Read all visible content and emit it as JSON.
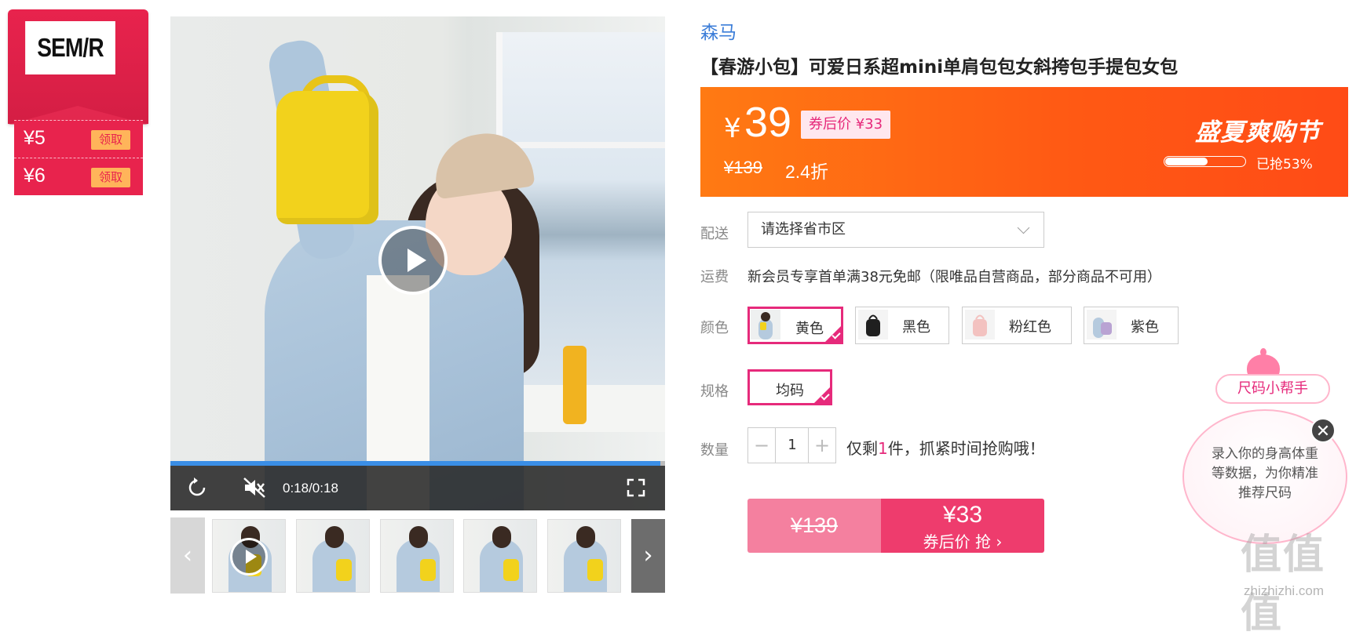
{
  "brand_badge": {
    "logo_text": "SEM/R"
  },
  "coupons": [
    {
      "amount": "¥5",
      "button": "领取"
    },
    {
      "amount": "¥6",
      "button": "领取"
    }
  ],
  "video": {
    "time": "0:18/0:18",
    "progress": 0.99
  },
  "thumbnails": {
    "prev": "‹",
    "next": "›"
  },
  "product": {
    "brand": "森马",
    "title": "【春游小包】可爱日系超mini单肩包包女斜挎包手提包女包"
  },
  "price_banner": {
    "currency": "¥",
    "price": "39",
    "coupon_price": "券后价 ¥33",
    "original_price": "¥139",
    "discount": "2.4折",
    "promo_title": "盛夏爽购节",
    "sold_text": "已抢53%",
    "sold_fraction": 0.53,
    "gradient_colors": [
      "#ff7a13",
      "#ff4b16"
    ]
  },
  "delivery": {
    "label": "配送",
    "placeholder": "请选择省市区"
  },
  "freight": {
    "label": "运费",
    "text": "新会员专享首单满38元免邮（限唯品自营商品，部分商品不可用）"
  },
  "color": {
    "label": "颜色",
    "options": [
      {
        "name": "黄色",
        "selected": true
      },
      {
        "name": "黑色",
        "selected": false
      },
      {
        "name": "粉红色",
        "selected": false
      },
      {
        "name": "紫色",
        "selected": false
      }
    ]
  },
  "size": {
    "label": "规格",
    "option": "均码"
  },
  "quantity": {
    "label": "数量",
    "minus": "−",
    "value": "1",
    "plus": "+",
    "stock_prefix": "仅剩",
    "stock_count": "1",
    "stock_suffix": "件，抓紧时间抢购哦！"
  },
  "buy": {
    "original_price": "¥139",
    "coupon_price": "¥33",
    "cta": "券后价 抢 ›"
  },
  "size_helper": {
    "button": "尺码小帮手",
    "text": "录入你的身高体重等数据，为你精准推荐尺码",
    "close": "✕"
  },
  "watermark": {
    "logo": "值值值",
    "url": "zhizhizhi.com"
  },
  "accent_colors": {
    "brand_red": "#e8234d",
    "pink": "#e62a7b",
    "orange": "#ff5a14",
    "link_blue": "#3b7dd8"
  }
}
